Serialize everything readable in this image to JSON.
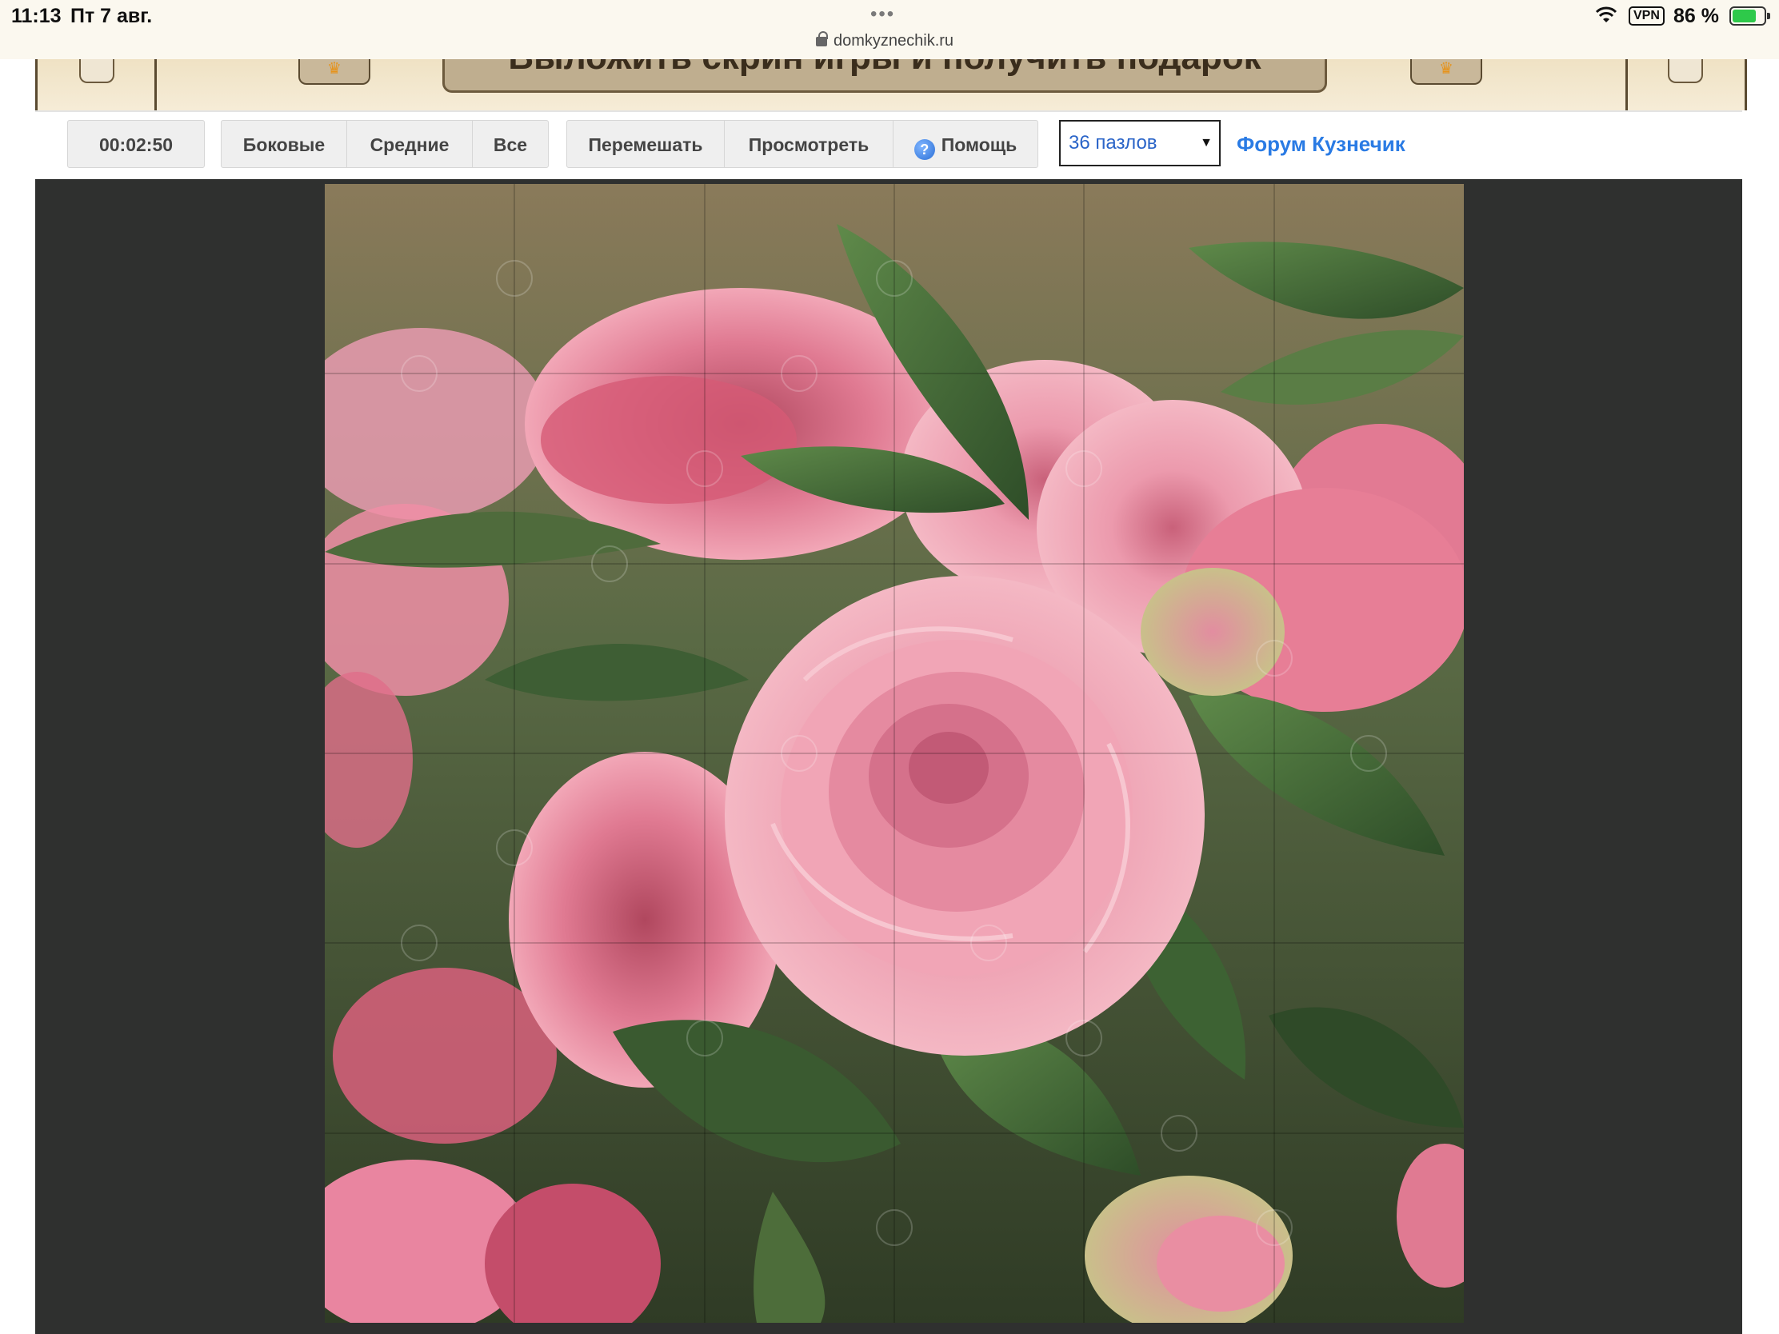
{
  "status_bar": {
    "time": "11:13",
    "date": "Пт 7 авг.",
    "dots": "•••",
    "url": "domkyznechik.ru",
    "vpn": "VPN",
    "battery_percent": "86 %",
    "battery_level": 0.86
  },
  "banner": {
    "text": "Выложить скрин игры и получить подарок"
  },
  "toolbar": {
    "timer": "00:02:50",
    "edge_label": "Боковые",
    "middle_label": "Средние",
    "all_label": "Все",
    "shuffle_label": "Перемешать",
    "preview_label": "Просмотреть",
    "help_label": "Помощь",
    "puzzle_count_selected": "36 пазлов",
    "forum_link": "Форум Кузнечик"
  },
  "puzzle": {
    "image_subject": "pink camellia flowers with green leaves",
    "grid": "6x6",
    "pieces": 36
  },
  "colors": {
    "link": "#2a7be4",
    "select_text": "#2a64c8",
    "game_background": "#2f302f",
    "toolbar_button_bg": "#efefef",
    "status_bar_bg": "#fbf8ef"
  }
}
